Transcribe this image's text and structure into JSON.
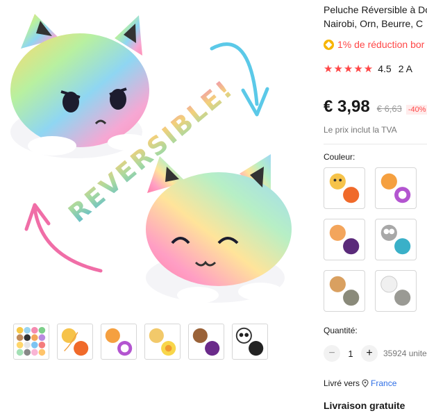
{
  "product": {
    "title_line1": "Peluche Réversible à Do",
    "title_line2": "Nairobi, Orn, Beurre, C",
    "main_image_text": "REVERSIBLE!",
    "promo_text": "1% de réduction bor",
    "rating_stars": "★★★★★",
    "rating_value": "4.5",
    "rating_extra": "2 A",
    "price": "€ 3,98",
    "old_price": "€ 6,63",
    "discount": "-40%",
    "tax_note": "Le prix inclut la TVA"
  },
  "options": {
    "color_label": "Couleur:",
    "swatches": [
      {
        "name": "tiger-fox"
      },
      {
        "name": "lion-unicorn"
      },
      {
        "name": "cat-wolf"
      },
      {
        "name": "owl-bird"
      },
      {
        "name": "hedgehog-sloth"
      },
      {
        "name": "ghost-rock"
      }
    ]
  },
  "quantity": {
    "label": "Quantité:",
    "value": "1",
    "minus": "−",
    "plus": "+",
    "stock": "35924 unite"
  },
  "shipping": {
    "ship_to_label": "Livré vers",
    "country": "France",
    "free_delivery": "Livraison gratuite"
  },
  "colors": {
    "accent": "#ff4747",
    "link": "#2e6ee6",
    "coin": "#f7b500"
  }
}
